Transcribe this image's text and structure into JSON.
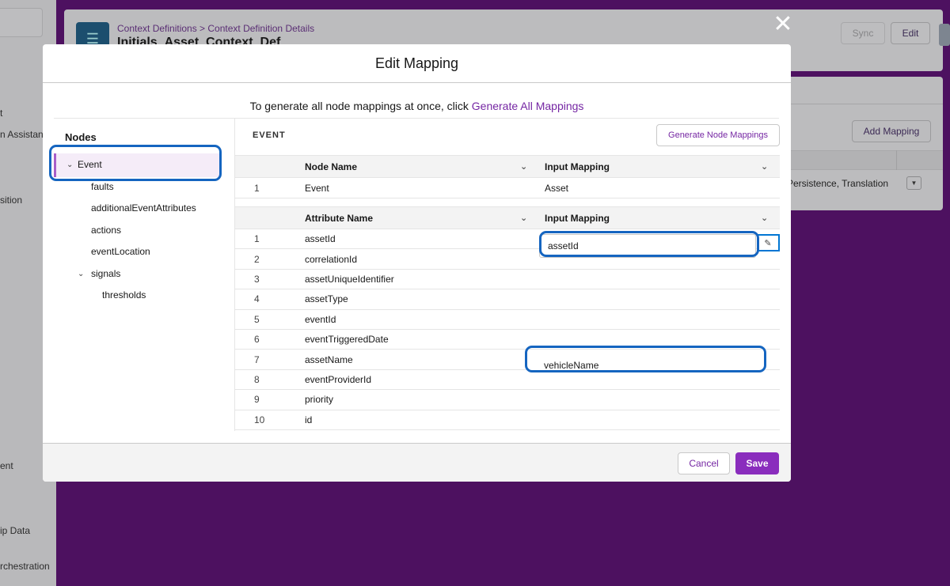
{
  "background": {
    "sidebar_labels": [
      "t",
      "n Assistan",
      "sition",
      "ent",
      "ip Data",
      "rchestration"
    ],
    "breadcrumb": "Context Definitions > Context Definition Details",
    "record_title": "Initials_Asset_Context_Def",
    "sync_label": "Sync",
    "edit_label": "Edit",
    "add_mapping_label": "Add Mapping",
    "row_cell": "Persistence, Translation"
  },
  "modal": {
    "title": "Edit Mapping",
    "generate_prompt": "To generate all node mappings at once, click",
    "generate_all_link": "Generate All Mappings",
    "nodes_title": "Nodes",
    "tree": [
      {
        "label": "Event",
        "expanded": true,
        "selected": true
      },
      {
        "label": "faults"
      },
      {
        "label": "additionalEventAttributes"
      },
      {
        "label": "actions"
      },
      {
        "label": "eventLocation"
      },
      {
        "label": "signals",
        "expanded": true
      },
      {
        "label": "thresholds"
      }
    ],
    "section_title": "EVENT",
    "generate_node_button": "Generate Node Mappings",
    "node_table": {
      "headers": [
        "Node Name",
        "Input Mapping"
      ],
      "rows": [
        {
          "num": "1",
          "name": "Event",
          "mapping": "Asset"
        }
      ]
    },
    "attr_table": {
      "headers": [
        "Attribute Name",
        "Input Mapping"
      ],
      "rows": [
        {
          "num": "1",
          "name": "assetId",
          "mapping": "assetId"
        },
        {
          "num": "2",
          "name": "correlationId",
          "mapping": ""
        },
        {
          "num": "3",
          "name": "assetUniqueIdentifier",
          "mapping": ""
        },
        {
          "num": "4",
          "name": "assetType",
          "mapping": ""
        },
        {
          "num": "5",
          "name": "eventId",
          "mapping": ""
        },
        {
          "num": "6",
          "name": "eventTriggeredDate",
          "mapping": ""
        },
        {
          "num": "7",
          "name": "assetName",
          "mapping": "vehicleName"
        },
        {
          "num": "8",
          "name": "eventProviderId",
          "mapping": ""
        },
        {
          "num": "9",
          "name": "priority",
          "mapping": ""
        },
        {
          "num": "10",
          "name": "id",
          "mapping": ""
        }
      ]
    },
    "cancel_label": "Cancel",
    "save_label": "Save"
  },
  "colors": {
    "brand_purple": "#7526a3",
    "save_button": "#8a2dbd",
    "overlay": "#4d1160",
    "highlight_ring": "#1565c0"
  },
  "icons": [
    "close-icon",
    "chevron-down-icon",
    "sort-chevron-icon",
    "pencil-icon",
    "dropdown-icon",
    "context-definition-icon"
  ]
}
